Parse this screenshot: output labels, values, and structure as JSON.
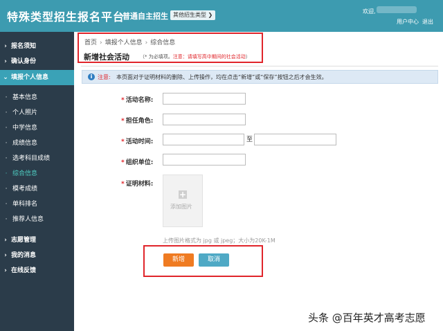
{
  "header": {
    "logo": "特殊类型招生报名平台",
    "subtitle": "普通自主招生",
    "type_button": "其他招生类型",
    "welcome": "欢迎,",
    "user_center": "用户中心",
    "logout": "退出"
  },
  "sidebar": {
    "items": [
      {
        "label": "报名须知",
        "kind": "top"
      },
      {
        "label": "确认身份",
        "kind": "top"
      },
      {
        "label": "填报个人信息",
        "kind": "top",
        "active": true
      },
      {
        "label": "基本信息",
        "kind": "sub"
      },
      {
        "label": "个人照片",
        "kind": "sub"
      },
      {
        "label": "中学信息",
        "kind": "sub"
      },
      {
        "label": "成绩信息",
        "kind": "sub"
      },
      {
        "label": "选考科目成绩",
        "kind": "sub"
      },
      {
        "label": "综合信息",
        "kind": "sub",
        "current": true
      },
      {
        "label": "模考成绩",
        "kind": "sub"
      },
      {
        "label": "单科排名",
        "kind": "sub"
      },
      {
        "label": "推荐人信息",
        "kind": "sub"
      },
      {
        "label": "志愿管理",
        "kind": "top"
      },
      {
        "label": "我的消息",
        "kind": "top"
      },
      {
        "label": "在线反馈",
        "kind": "top"
      }
    ]
  },
  "breadcrumb": {
    "items": [
      "首页",
      "填报个人信息",
      "综合信息"
    ]
  },
  "page": {
    "title": "新增社会活动",
    "note_prefix": "（* 为必填项。",
    "note_warn": "注意：请填写高中期间的社会活动",
    "note_suffix": "）"
  },
  "notice": {
    "label": "注意:",
    "text": "本页面对于证明材料的删除、上传操作，均在点击“新增”或“保存”按钮之后才会生效。"
  },
  "form": {
    "activity_name_label": "活动名称:",
    "role_label": "担任角色:",
    "time_label": "活动时间:",
    "to_label": "至",
    "org_label": "组织单位:",
    "proof_label": "证明材料:",
    "add_image": "添加图片",
    "upload_hint": "上传图片格式为 jpg 或 jpeg；大小为20K-1M"
  },
  "buttons": {
    "add": "新增",
    "cancel": "取消"
  },
  "watermark": "头条 @百年英才高考志愿",
  "colors": {
    "header": "#3d9bb0",
    "sidebar": "#2b3c4a",
    "active": "#3aa2b7",
    "highlight": "#e0242a",
    "add_button": "#ef7b22",
    "cancel_button": "#4fa9c5"
  }
}
